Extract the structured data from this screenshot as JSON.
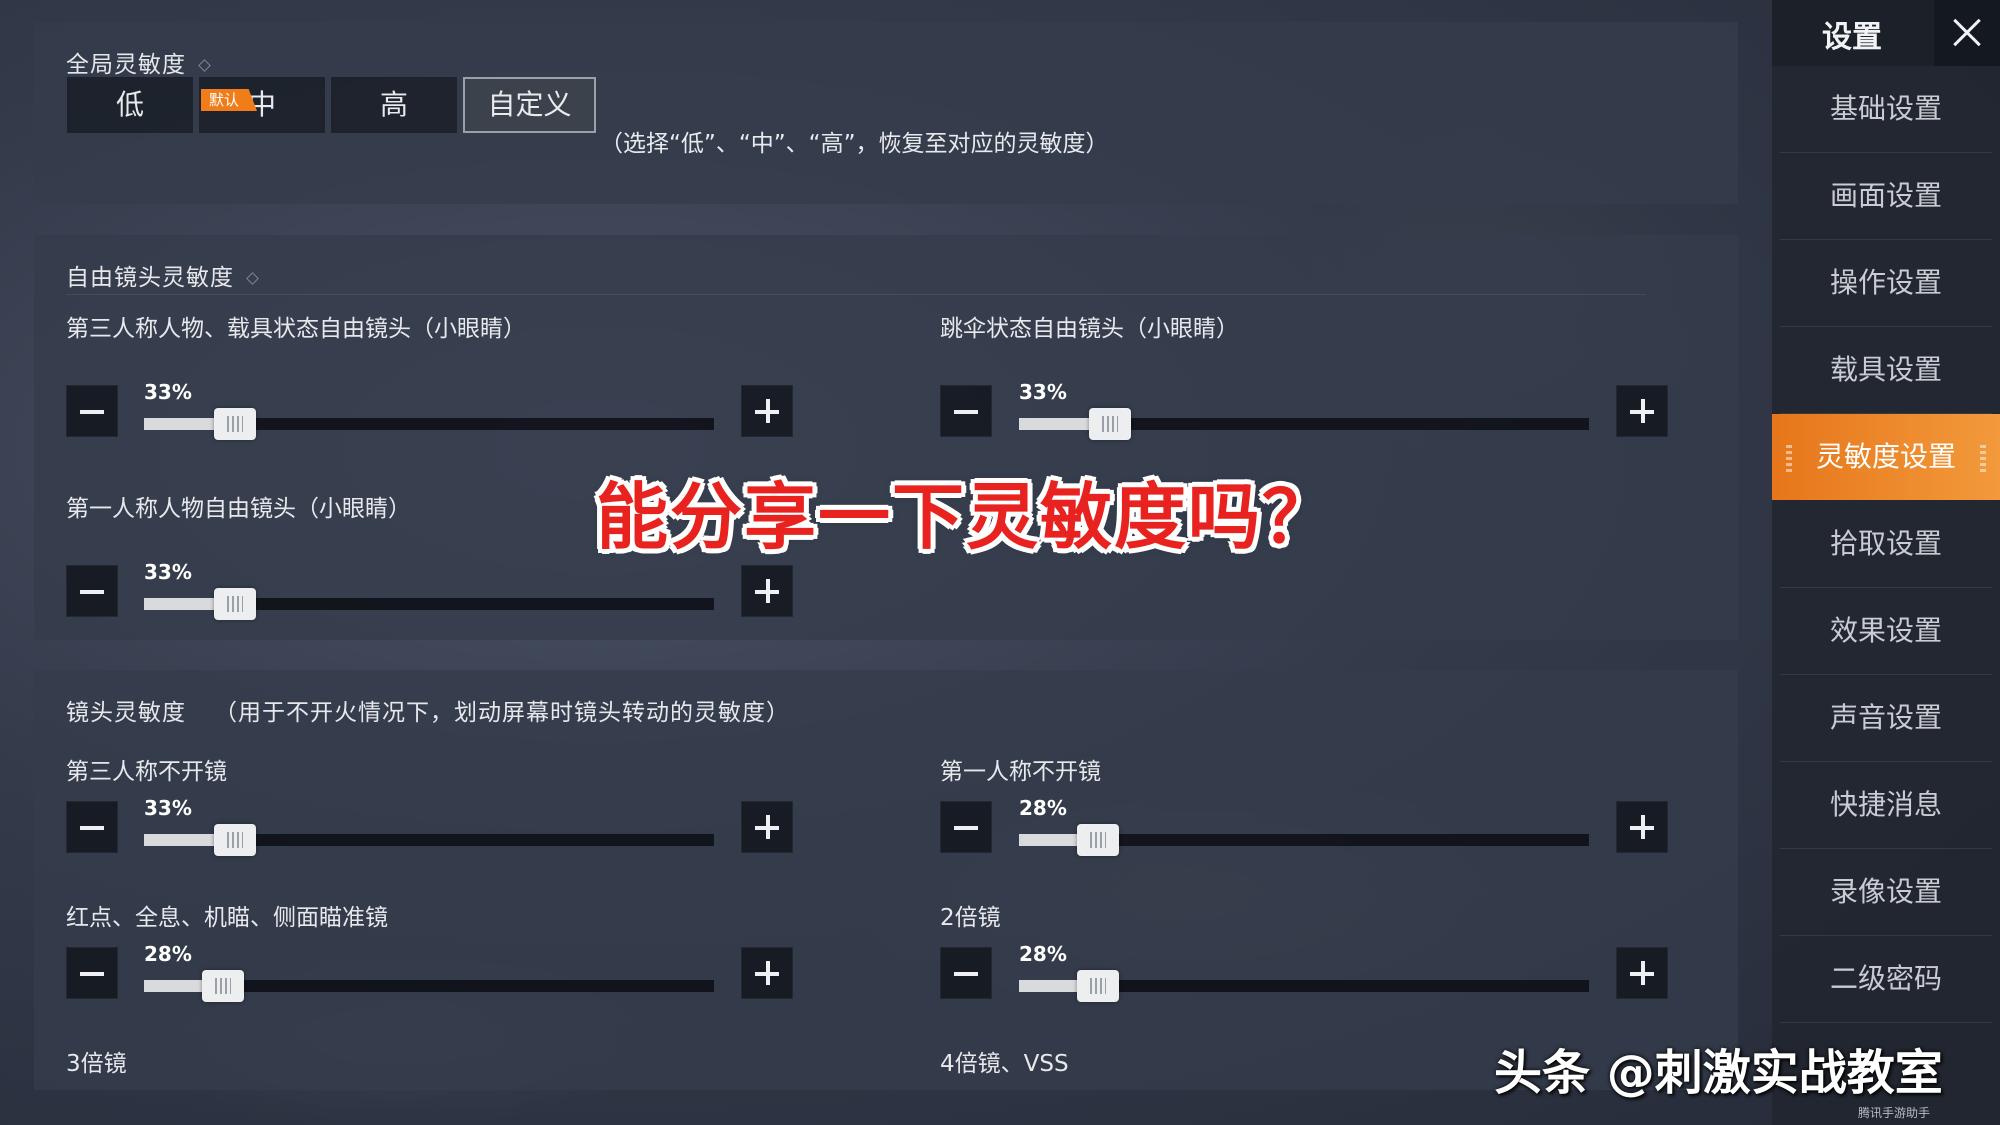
{
  "global_sensitivity": {
    "title": "全局灵敏度",
    "default_tag": "默认",
    "presets": [
      "低",
      "中",
      "高",
      "自定义"
    ],
    "hint": "（选择“低”、“中”、“高”，恢复至对应的灵敏度）"
  },
  "free_look": {
    "title": "自由镜头灵敏度",
    "rows": [
      {
        "label": "第三人称人物、载具状态自由镜头（小眼睛）",
        "percent": "33%"
      },
      {
        "label": "跳伞状态自由镜头（小眼睛）",
        "percent": "33%"
      },
      {
        "label": "第一人称人物自由镜头（小眼睛）",
        "percent": "33%"
      }
    ]
  },
  "camera": {
    "title": "镜头灵敏度",
    "subtitle": "（用于不开火情况下，划动屏幕时镜头转动的灵敏度）",
    "rows": [
      {
        "label": "第三人称不开镜",
        "percent": "33%"
      },
      {
        "label": "第一人称不开镜",
        "percent": "28%"
      },
      {
        "label": "红点、全息、机瞄、侧面瞄准镜",
        "percent": "28%"
      },
      {
        "label": "2倍镜",
        "percent": "28%"
      },
      {
        "label": "3倍镜"
      },
      {
        "label": "4倍镜、VSS"
      }
    ]
  },
  "slider_levels": [
    0.33,
    0.33,
    0.33,
    0.33,
    0.28,
    0.28,
    0.28
  ],
  "sidebar": {
    "title": "设置",
    "items": [
      "基础设置",
      "画面设置",
      "操作设置",
      "载具设置",
      "灵敏度设置",
      "拾取设置",
      "效果设置",
      "声音设置",
      "快捷消息",
      "录像设置",
      "二级密码"
    ],
    "active": "灵敏度设置"
  },
  "overlay": {
    "caption": "能分享一下灵敏度吗？",
    "watermark": "头条 @刺激实战教室",
    "small_mark": "腾讯手游助手"
  },
  "colors": {
    "accent": "#f07d1a",
    "caption_red": "#e8231f"
  }
}
